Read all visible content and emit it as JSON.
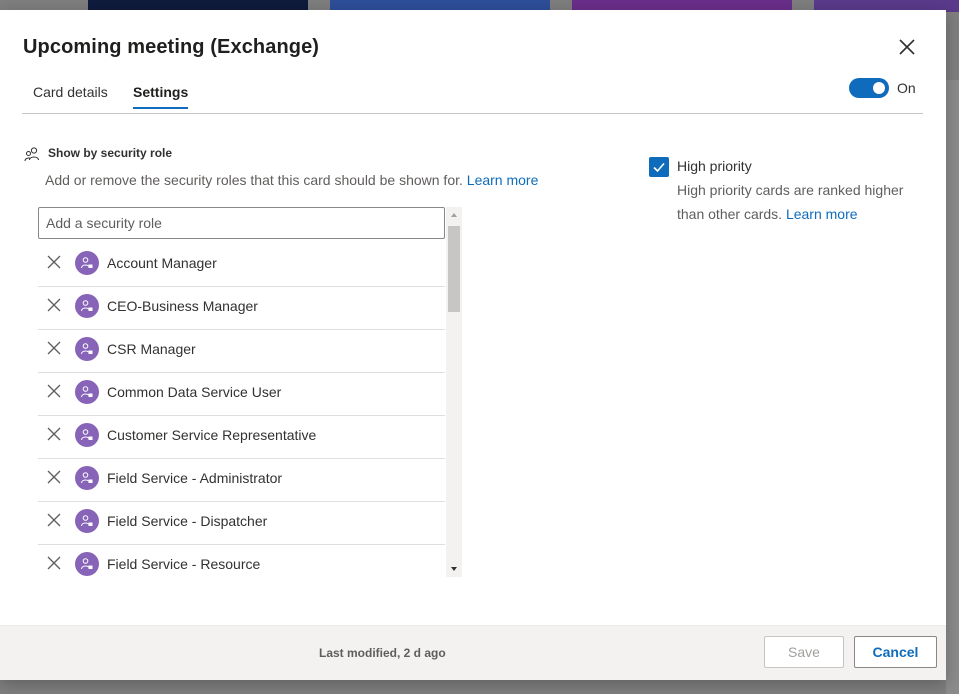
{
  "dialog": {
    "title": "Upcoming meeting (Exchange)",
    "tabs": [
      {
        "label": "Card details",
        "active": false
      },
      {
        "label": "Settings",
        "active": true
      }
    ],
    "toggle": {
      "state_label": "On",
      "on": true,
      "color": "#0f6cbd"
    }
  },
  "security": {
    "title": "Show by security role",
    "description": "Add or remove the security roles that this card should be shown for.",
    "link": "Learn more",
    "search_placeholder": "Add a security role",
    "roles": [
      "Account Manager",
      "CEO-Business Manager",
      "CSR Manager",
      "Common Data Service User",
      "Customer Service Representative",
      "Field Service - Administrator",
      "Field Service - Dispatcher",
      "Field Service - Resource"
    ],
    "avatar_color": "#8764b8"
  },
  "priority": {
    "label": "High priority",
    "checked": true,
    "description": "High priority cards are ranked higher than other cards.",
    "link": "Learn more"
  },
  "footer": {
    "last_modified": "Last modified, 2 d ago",
    "save_label": "Save",
    "cancel_label": "Cancel"
  },
  "icons": {
    "close": "close-icon",
    "section": "people-icon",
    "remove": "remove-icon",
    "avatar": "security-role-icon",
    "check": "checkmark-icon"
  }
}
